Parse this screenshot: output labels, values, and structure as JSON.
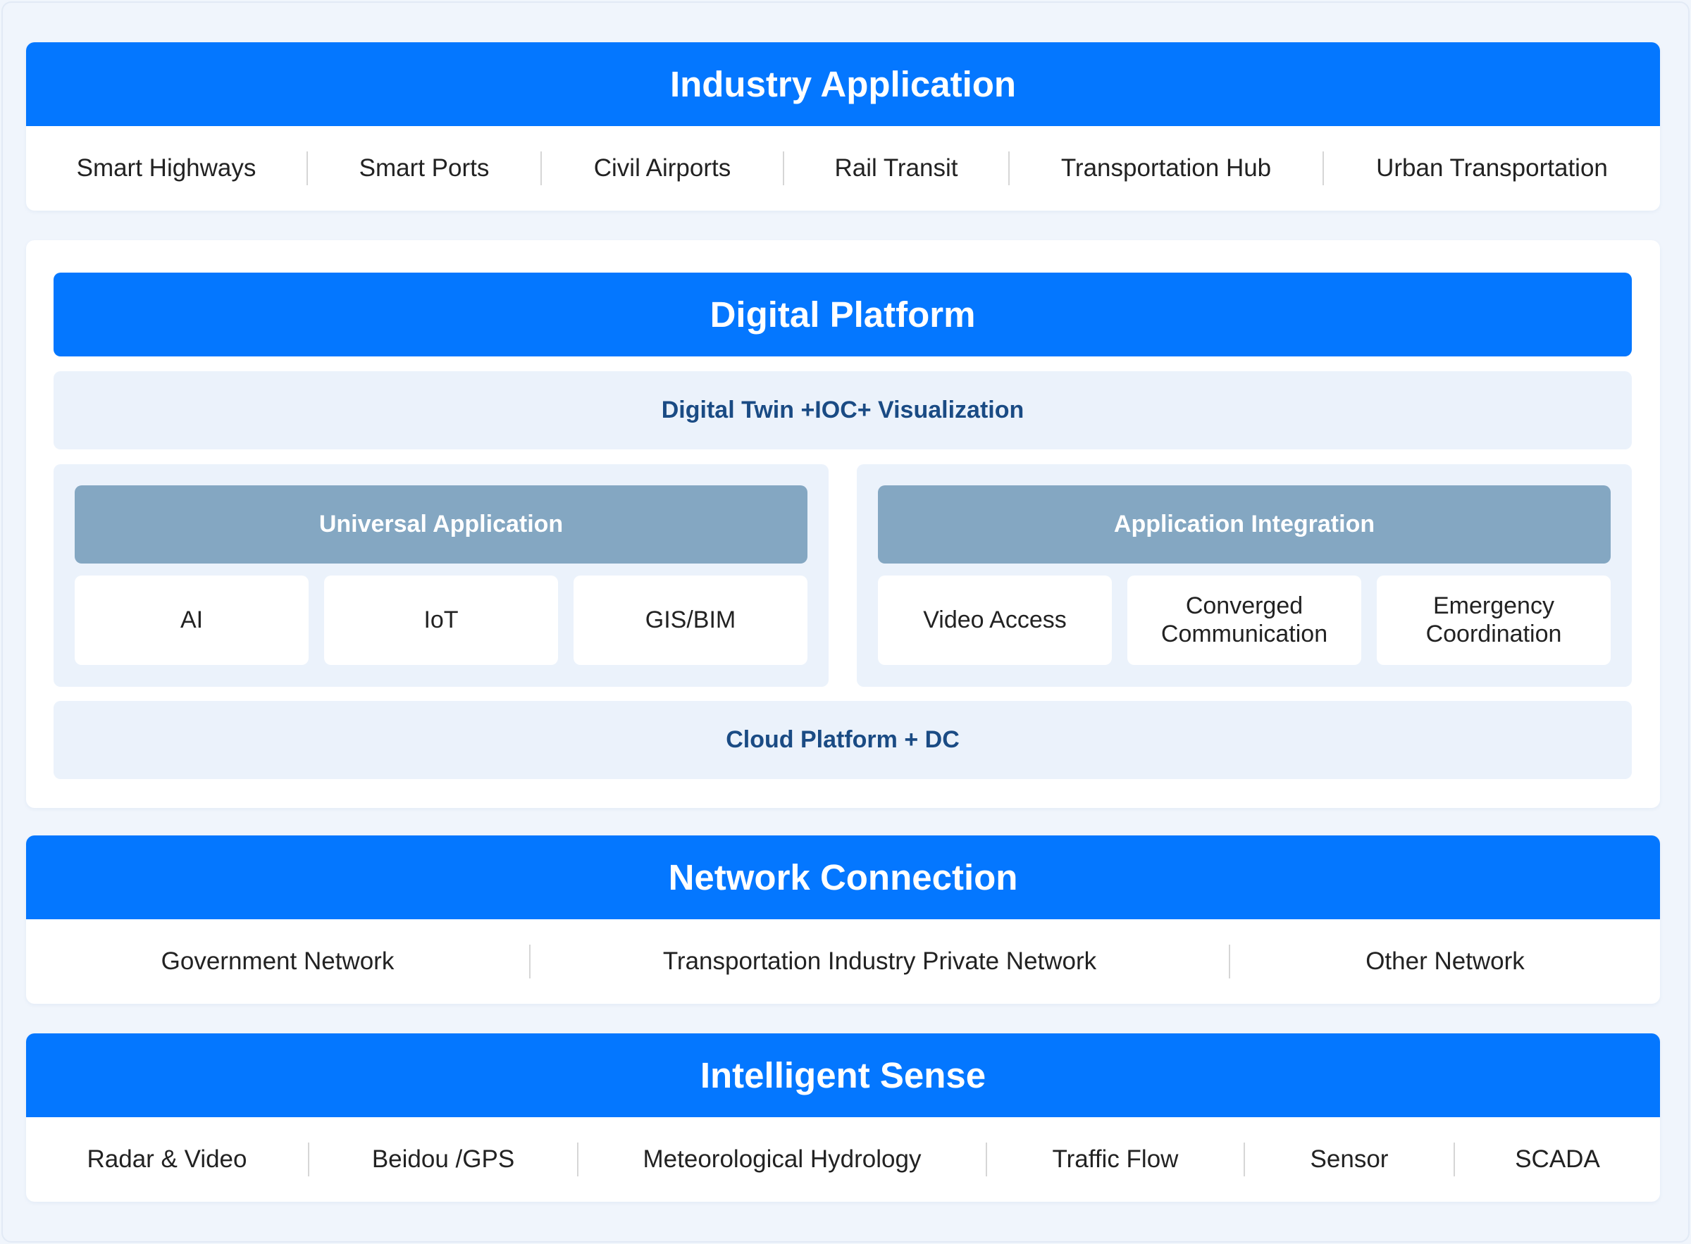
{
  "industry_application": {
    "title": "Industry Application",
    "items": [
      "Smart Highways",
      "Smart Ports",
      "Civil Airports",
      "Rail Transit",
      "Transportation Hub",
      "Urban Transportation"
    ]
  },
  "digital_platform": {
    "title": "Digital Platform",
    "top_layer": "Digital Twin +IOC+ Visualization",
    "universal_application": {
      "title": "Universal Application",
      "items": [
        "AI",
        "IoT",
        "GIS/BIM"
      ]
    },
    "application_integration": {
      "title": "Application Integration",
      "items": [
        {
          "line1": "Video Access",
          "line2": ""
        },
        {
          "line1": "Converged",
          "line2": "Communication"
        },
        {
          "line1": "Emergency",
          "line2": "Coordination"
        }
      ]
    },
    "bottom_layer": "Cloud Platform + DC"
  },
  "network_connection": {
    "title": "Network Connection",
    "items": [
      "Government Network",
      "Transportation Industry Private Network",
      "Other Network"
    ]
  },
  "intelligent_sense": {
    "title": "Intelligent Sense",
    "items": [
      "Radar & Video",
      "Beidou /GPS",
      "Meteorological Hydrology",
      "Traffic Flow",
      "Sensor",
      "SCADA"
    ]
  },
  "colors": {
    "accent_blue": "#0477ff",
    "group_header": "#84a7c2",
    "sub_band_text": "#1a4b84",
    "background": "#f0f5fc"
  }
}
